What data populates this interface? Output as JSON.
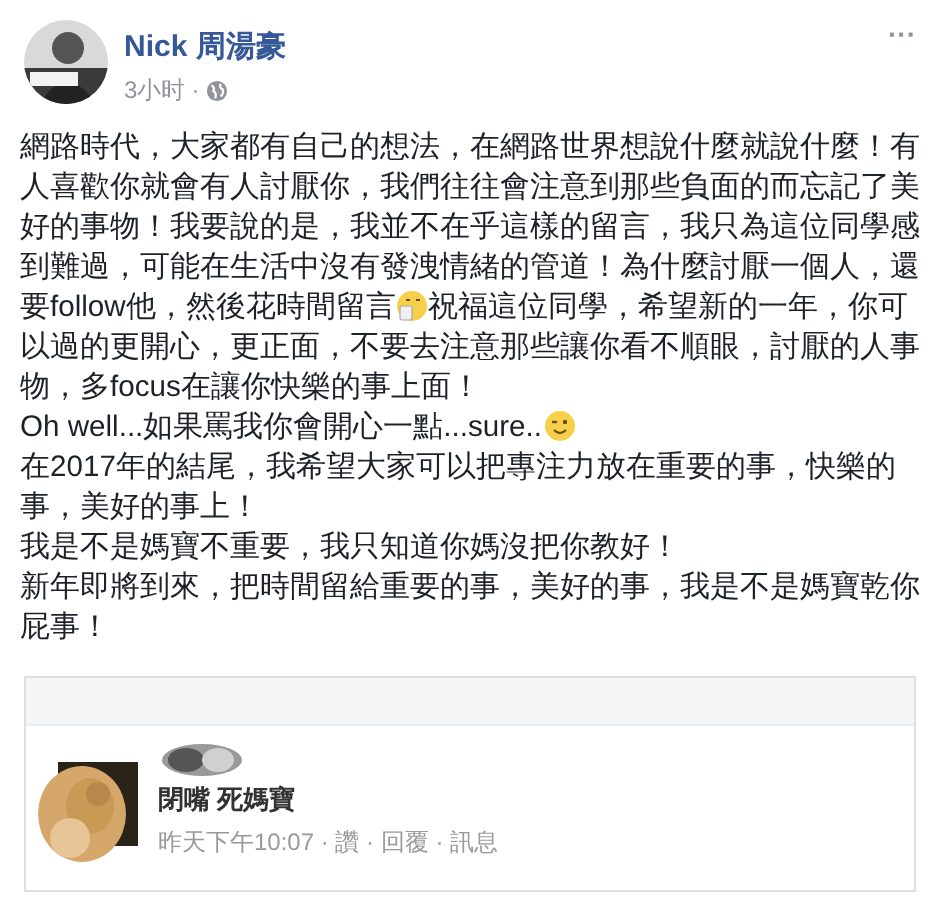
{
  "post": {
    "author": "Nick 周湯豪",
    "time": "3小时",
    "separator": "·",
    "menu": "···",
    "lines": [
      {
        "segments": [
          {
            "kind": "text",
            "text": "網路時代，大家都有自己的想法，在網路世界想說什麼就說什麼！有"
          }
        ]
      },
      {
        "segments": [
          {
            "kind": "text",
            "text": "人喜歡你就會有人討厭你，我們往往會注意到那些負面的而忘記了美"
          }
        ]
      },
      {
        "segments": [
          {
            "kind": "text",
            "text": "好的事物！我要說的是，我並不在乎這樣的留言，我只為這位同學感"
          }
        ]
      },
      {
        "segments": [
          {
            "kind": "text",
            "text": "到難過，可能在生活中沒有發洩情緒的管道！為什麼討厭一個人，還"
          }
        ]
      },
      {
        "segments": [
          {
            "kind": "text",
            "text": "要follow他，然後花時間留言"
          },
          {
            "kind": "emoji_shy"
          },
          {
            "kind": "text",
            "text": "祝福這位同學，希望新的一年，你可"
          }
        ]
      },
      {
        "segments": [
          {
            "kind": "text",
            "text": "以過的更開心，更正面，不要去注意那些讓你看不順眼，討厭的人事"
          }
        ]
      },
      {
        "segments": [
          {
            "kind": "text",
            "text": "物，多focus在讓你快樂的事上面！"
          }
        ]
      },
      {
        "segments": [
          {
            "kind": "text",
            "text": "Oh well...如果罵我你會開心一點...sure.."
          },
          {
            "kind": "emoji_wink"
          }
        ]
      },
      {
        "segments": [
          {
            "kind": "text",
            "text": "在2017年的結尾，我希望大家可以把專注力放在重要的事，快樂的"
          }
        ]
      },
      {
        "segments": [
          {
            "kind": "text",
            "text": "事，美好的事上！"
          }
        ]
      },
      {
        "segments": [
          {
            "kind": "text",
            "text": "我是不是媽寶不重要，我只知道你媽沒把你教好！"
          }
        ]
      },
      {
        "segments": [
          {
            "kind": "text",
            "text": "新年即將到來，把時間留給重要的事，美好的事，我是不是媽寶乾你"
          }
        ]
      },
      {
        "segments": [
          {
            "kind": "text",
            "text": "屁事！"
          }
        ]
      }
    ]
  },
  "comment_screenshot": {
    "text": "閉嘴 死媽寶",
    "meta": "昨天下午10:07 · 讚 · 回覆 · 訊息"
  }
}
